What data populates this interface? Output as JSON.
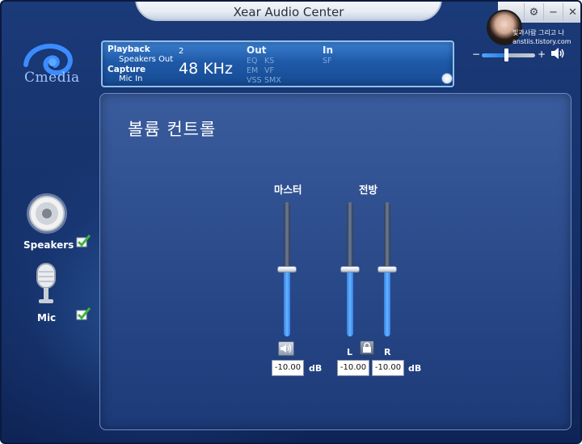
{
  "window": {
    "title": "Xear Audio Center"
  },
  "logo": {
    "text": "Cmedia"
  },
  "info_panel": {
    "playback_label": "Playback",
    "playback_value": "Speakers Out",
    "capture_label": "Capture",
    "capture_value": "Mic In",
    "channels": "2",
    "sample_rate": "48 KHz",
    "out_header": "Out",
    "out_items": [
      "EQ",
      "KS",
      "EM",
      "VF",
      "VSS",
      "SMX"
    ],
    "in_header": "In",
    "in_items": [
      "SF"
    ]
  },
  "watermark": {
    "line1": "빛과사람 그리고 나",
    "line2": "anstiis.tistory.com"
  },
  "master_volume": {
    "minus": "−",
    "plus": "+",
    "level": 0.45
  },
  "sidebar": {
    "devices": [
      {
        "label": "Speakers",
        "checked": true
      },
      {
        "label": "Mic",
        "checked": true
      }
    ]
  },
  "main": {
    "title": "볼륨 컨트롤",
    "master_group_label": "마스터",
    "front_group_label": "전방",
    "left_label": "L",
    "right_label": "R",
    "master_db": "-10.00",
    "front_left_db": "-10.00",
    "front_right_db": "-10.00",
    "db_unit": "dB",
    "master_level": 0.5,
    "front_left_level": 0.5,
    "front_right_level": 0.5
  }
}
